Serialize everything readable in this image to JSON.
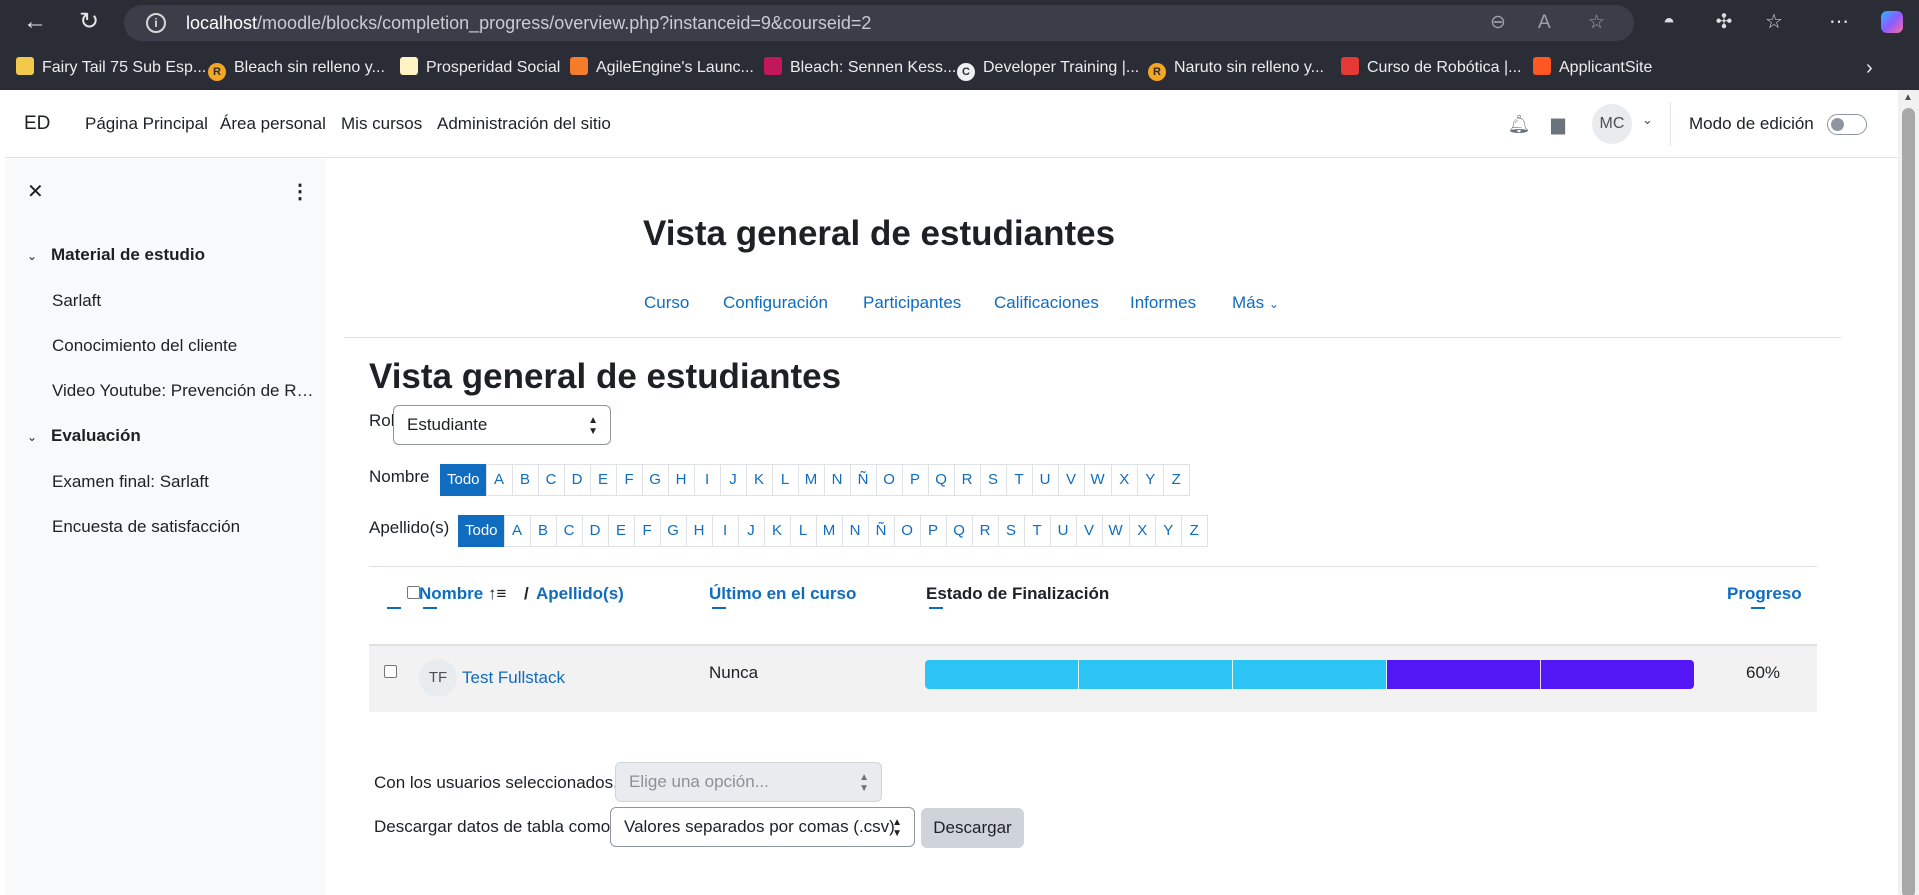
{
  "browser": {
    "url_host": "localhost",
    "url_path": "/moodle/blocks/completion_progress/overview.php?instanceid=9&courseid=2",
    "bookmarks": [
      {
        "label": "Fairy Tail 75 Sub Esp...",
        "icon": "fairy-tail-icon"
      },
      {
        "label": "Bleach sin relleno y...",
        "icon": "r-badge-icon"
      },
      {
        "label": "Prosperidad Social",
        "icon": "prosperidad-icon"
      },
      {
        "label": "AgileEngine's Launc...",
        "icon": "rocket-icon"
      },
      {
        "label": "Bleach: Sennen Kess...",
        "icon": "bleach-icon"
      },
      {
        "label": "Developer Training |...",
        "icon": "c-badge-icon"
      },
      {
        "label": "Naruto sin relleno y...",
        "icon": "r-badge-icon"
      },
      {
        "label": "Curso de Robótica |...",
        "icon": "robotica-icon"
      },
      {
        "label": "ApplicantSite",
        "icon": "applicantsite-icon"
      }
    ]
  },
  "navbar": {
    "site_short": "ED",
    "items": [
      "Página Principal",
      "Área personal",
      "Mis cursos",
      "Administración del sitio"
    ],
    "user_initials": "MC",
    "edit_mode_label": "Modo de edición"
  },
  "drawer": {
    "sections": [
      {
        "title": "Material de estudio",
        "items": [
          "Sarlaft",
          "Conocimiento del cliente",
          "Video Youtube: Prevención de Ri..."
        ]
      },
      {
        "title": "Evaluación",
        "items": [
          "Examen final: Sarlaft",
          "Encuesta de satisfacción"
        ]
      }
    ]
  },
  "page": {
    "header": "Vista general de estudiantes",
    "secondary_nav": [
      "Curso",
      "Configuración",
      "Participantes",
      "Calificaciones",
      "Informes",
      "Más"
    ],
    "title": "Vista general de estudiantes"
  },
  "filters": {
    "role_label": "Rol",
    "role_value": "Estudiante",
    "firstname_label": "Nombre",
    "lastname_label": "Apellido(s)",
    "all_label": "Todo",
    "letters": [
      "A",
      "B",
      "C",
      "D",
      "E",
      "F",
      "G",
      "H",
      "I",
      "J",
      "K",
      "L",
      "M",
      "N",
      "Ñ",
      "O",
      "P",
      "Q",
      "R",
      "S",
      "T",
      "U",
      "V",
      "W",
      "X",
      "Y",
      "Z"
    ]
  },
  "table": {
    "col_name": "Nombre",
    "col_separator": "/",
    "col_lastname": "Apellido(s)",
    "col_last_access": "Último en el curso",
    "col_status": "Estado de Finalización",
    "col_progress": "Progreso",
    "rows": [
      {
        "initials": "TF",
        "name": "Test Fullstack",
        "last_access": "Nunca",
        "segments": [
          "complete",
          "complete",
          "complete",
          "incomplete",
          "incomplete"
        ],
        "progress": "60%"
      }
    ],
    "colors": {
      "complete": "#2bc4f5",
      "incomplete": "#5316f4"
    }
  },
  "footer": {
    "with_selected_label": "Con los usuarios seleccionados...",
    "with_selected_placeholder": "Elige una opción...",
    "download_label": "Descargar datos de tabla como",
    "download_format": "Valores separados por comas (.csv)",
    "download_button": "Descargar"
  }
}
